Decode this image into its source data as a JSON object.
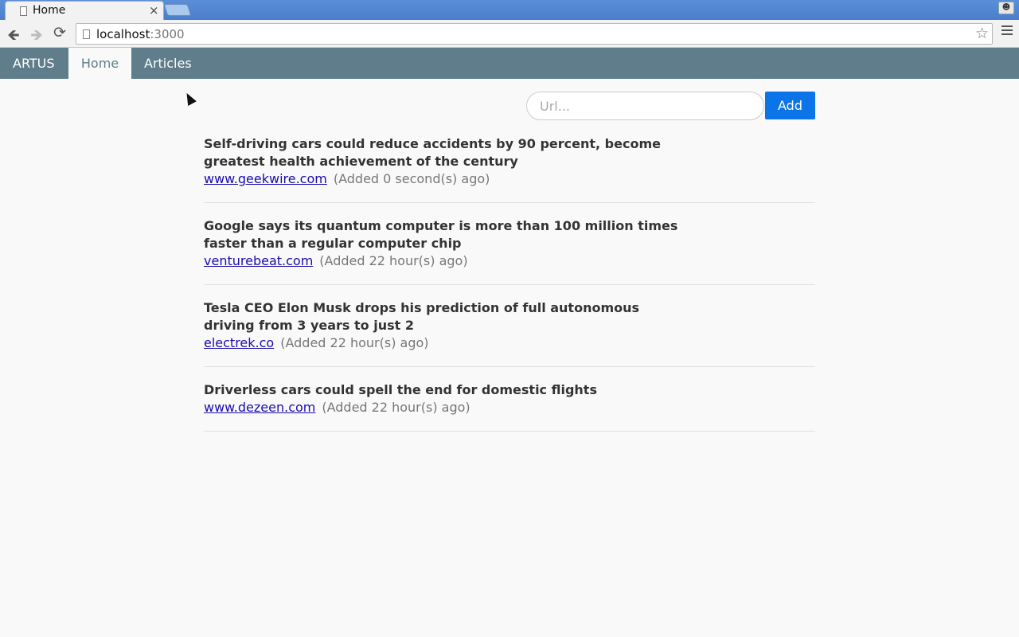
{
  "browser": {
    "tab_title": "Home",
    "tab_close": "×",
    "url_host": "localhost",
    "url_port": ":3000",
    "icons": {
      "back": "back-arrow-icon",
      "forward": "forward-arrow-icon",
      "reload": "reload-icon",
      "star": "bookmark-star-icon",
      "menu": "hamburger-menu-icon",
      "profile": "profile-icon"
    }
  },
  "nav": {
    "brand": "ARTUS",
    "items": [
      {
        "label": "Home",
        "active": true
      },
      {
        "label": "Articles",
        "active": false
      }
    ]
  },
  "form": {
    "placeholder": "Url...",
    "button_label": "Add"
  },
  "articles": [
    {
      "title": "Self-driving cars could reduce accidents by 90 percent, become greatest health achievement of the century",
      "source": "www.geekwire.com",
      "added": "(Added 0 second(s) ago)"
    },
    {
      "title": "Google says its quantum computer is more than 100 million times faster than a regular computer chip",
      "source": "venturebeat.com",
      "added": "(Added 22 hour(s) ago)"
    },
    {
      "title": "Tesla CEO Elon Musk drops his prediction of full autonomous driving from 3 years to just 2",
      "source": "electrek.co",
      "added": "(Added 22 hour(s) ago)"
    },
    {
      "title": "Driverless cars could spell the end for domestic flights",
      "source": "www.dezeen.com",
      "added": "(Added 22 hour(s) ago)"
    }
  ],
  "colors": {
    "navbar": "#607d8b",
    "add_button": "#0a74e8",
    "link": "#1a0dab",
    "background": "#f9f9f9"
  }
}
